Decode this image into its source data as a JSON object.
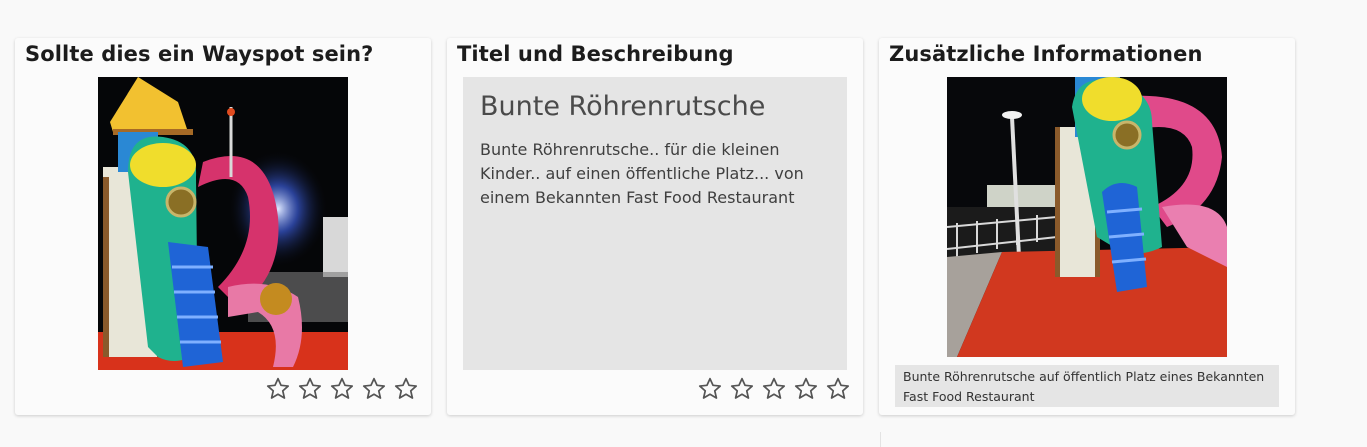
{
  "cards": [
    {
      "title": "Sollte dies ein Wayspot sein?",
      "image": "playground-tube-slide-night-photo",
      "rating": 0
    },
    {
      "title": "Titel und Beschreibung",
      "wayspot_title": "Bunte Röhrenrutsche",
      "wayspot_description": "Bunte Röhrenrutsche.. für die kleinen Kinder.. auf einen öffentliche Platz... von einem Bekannten Fast Food Restaurant",
      "rating": 0
    },
    {
      "title": "Zusätzliche Informationen",
      "image": "playground-tube-slide-supporting-photo",
      "supporting_text": "Bunte Röhrenrutsche auf öffentlich Platz eines Bekannten Fast Food Restaurant"
    }
  ],
  "icons": {
    "rating": "star-outline-icon"
  },
  "colors": {
    "star_outline": "#555555",
    "panel_gray": "#e5e5e5",
    "card_bg": "#fbfbfb"
  }
}
